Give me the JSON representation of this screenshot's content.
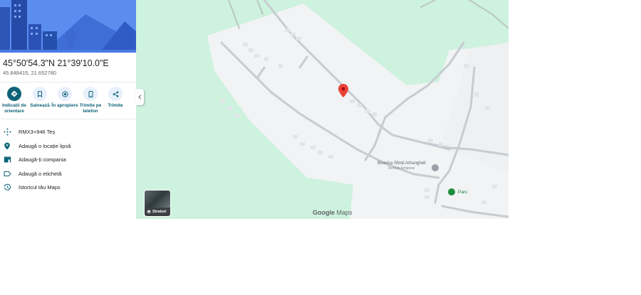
{
  "place": {
    "title": "45°50'54.3\"N 21°39'10.0\"E",
    "decimal": "45.848415, 21.652780"
  },
  "actions": [
    {
      "label": "Indicații de orientare",
      "icon": "directions-icon"
    },
    {
      "label": "Salvează",
      "icon": "bookmark-icon"
    },
    {
      "label": "În apropiere",
      "icon": "nearby-icon"
    },
    {
      "label": "Trimite pe telefon",
      "icon": "phone-icon"
    },
    {
      "label": "Trimite",
      "icon": "share-icon"
    }
  ],
  "details": [
    {
      "text": "RMX3+946 Teș",
      "icon": "plus-code-icon"
    },
    {
      "text": "Adaugă o locație lipsă",
      "icon": "add-location-icon"
    },
    {
      "text": "Adaugă-ți compania",
      "icon": "business-icon"
    },
    {
      "text": "Adaugă o etichetă",
      "icon": "label-icon"
    },
    {
      "text": "Istoricul tău Maps",
      "icon": "history-icon"
    }
  ],
  "map": {
    "layers_label": "Straturi",
    "logo_google": "Google",
    "logo_maps": "Maps",
    "poi_church": "Biserica Sfinții Arhangheli",
    "poi_church_sub": "Închisă temporar",
    "poi_park": "Parc"
  },
  "colors": {
    "accent": "#0e6378",
    "map_green": "#cdf2de",
    "map_land": "#f1f3f4",
    "pin": "#ea4335"
  }
}
